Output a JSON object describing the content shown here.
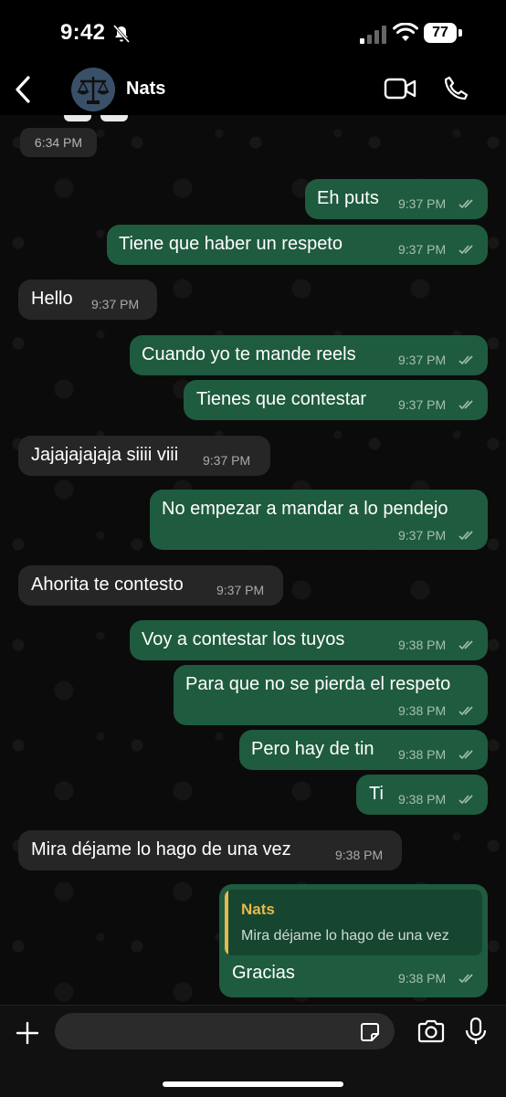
{
  "status_bar": {
    "time": "9:42",
    "battery": "77",
    "icons": [
      "bell-slash-icon",
      "signal-icon",
      "wifi-icon",
      "battery-icon"
    ]
  },
  "header": {
    "contact_name": "Nats",
    "icons": [
      "back-icon",
      "video-call-icon",
      "phone-icon"
    ]
  },
  "chat": {
    "first_time": "6:34 PM",
    "messages": [
      {
        "dir": "out",
        "text": "Eh puts",
        "time": "9:37 PM"
      },
      {
        "dir": "out",
        "text": "Tiene que haber un respeto",
        "time": "9:37 PM"
      },
      {
        "dir": "in",
        "text": "Hello",
        "time": "9:37 PM"
      },
      {
        "dir": "out",
        "text": "Cuando yo te mande reels",
        "time": "9:37 PM"
      },
      {
        "dir": "out",
        "text": "Tienes que contestar",
        "time": "9:37 PM"
      },
      {
        "dir": "in",
        "text": "Jajajajajaja siiii viii",
        "time": "9:37 PM"
      },
      {
        "dir": "out",
        "text": "No empezar a mandar a lo pendejo",
        "time": "9:37 PM"
      },
      {
        "dir": "in",
        "text": "Ahorita te contesto",
        "time": "9:37 PM"
      },
      {
        "dir": "out",
        "text": "Voy a contestar los tuyos",
        "time": "9:38 PM"
      },
      {
        "dir": "out",
        "text": "Para que no se pierda el respeto",
        "time": "9:38 PM"
      },
      {
        "dir": "out",
        "text": "Pero hay de tin",
        "time": "9:38 PM"
      },
      {
        "dir": "out",
        "text": "Ti",
        "time": "9:38 PM"
      },
      {
        "dir": "in",
        "text": "Mira déjame lo hago de una vez",
        "time": "9:38 PM"
      },
      {
        "dir": "out",
        "text": "Gracias",
        "time": "9:38 PM",
        "reply_to": {
          "name": "Nats",
          "text": "Mira déjame lo hago de una vez"
        }
      }
    ]
  },
  "composer": {
    "placeholder": "",
    "icons": [
      "plus-icon",
      "sticker-icon",
      "camera-icon",
      "mic-icon"
    ]
  },
  "colors": {
    "incoming_bubble": "#262626",
    "outgoing_bubble": "#1f5b3f",
    "quote_accent": "#e9b949"
  }
}
